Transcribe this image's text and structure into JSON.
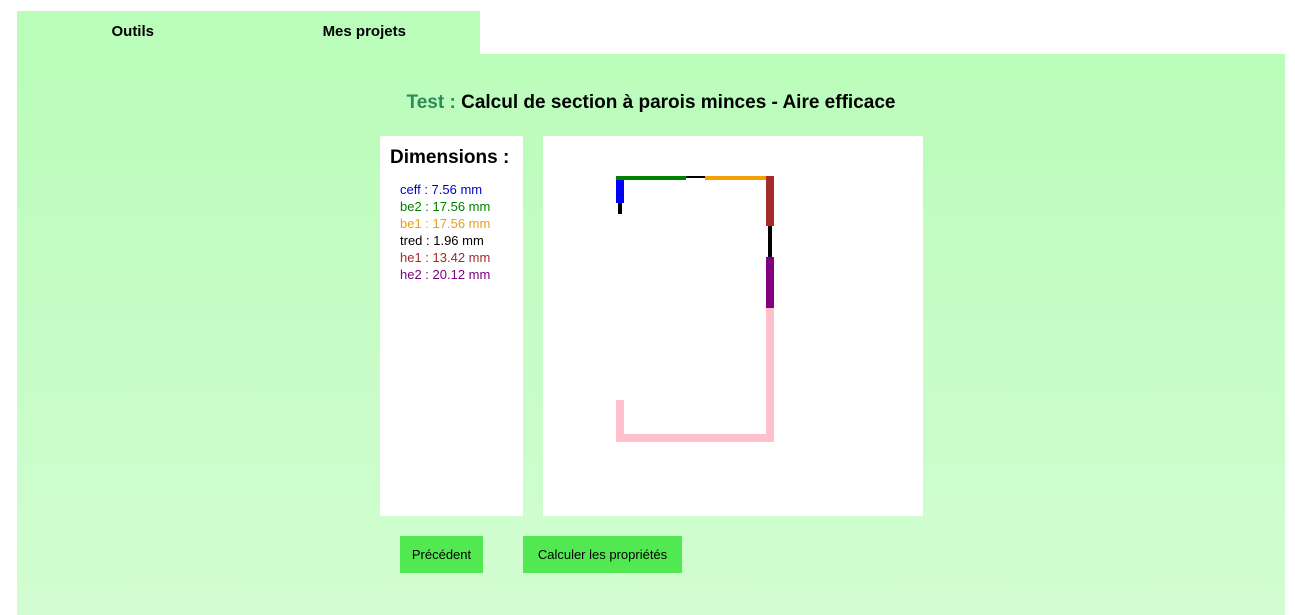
{
  "tabs": [
    {
      "label": "Outils"
    },
    {
      "label": "Mes projets"
    }
  ],
  "header": {
    "project": "Test :",
    "title": "Calcul de section à parois minces - Aire efficace"
  },
  "dimensions": {
    "heading": "Dimensions :",
    "items": [
      {
        "text": "ceff : 7.56 mm",
        "color": "#0000cd"
      },
      {
        "text": "be2 : 17.56 mm",
        "color": "#008000"
      },
      {
        "text": "be1 : 17.56 mm",
        "color": "#e6a020"
      },
      {
        "text": "tred : 1.96 mm",
        "color": "#000000"
      },
      {
        "text": "he1 : 13.42 mm",
        "color": "#a52a2a"
      },
      {
        "text": "he2 : 20.12 mm",
        "color": "#800080"
      }
    ]
  },
  "diagram_colors": {
    "ceff": "#0000ff",
    "be2": "#008000",
    "be1": "#f0a000",
    "tred": "#000000",
    "he1": "#a52a2a",
    "he2": "#800080",
    "section": "#ffc0cb"
  },
  "buttons": {
    "previous": "Précédent",
    "calculate": "Calculer les propriétés"
  }
}
